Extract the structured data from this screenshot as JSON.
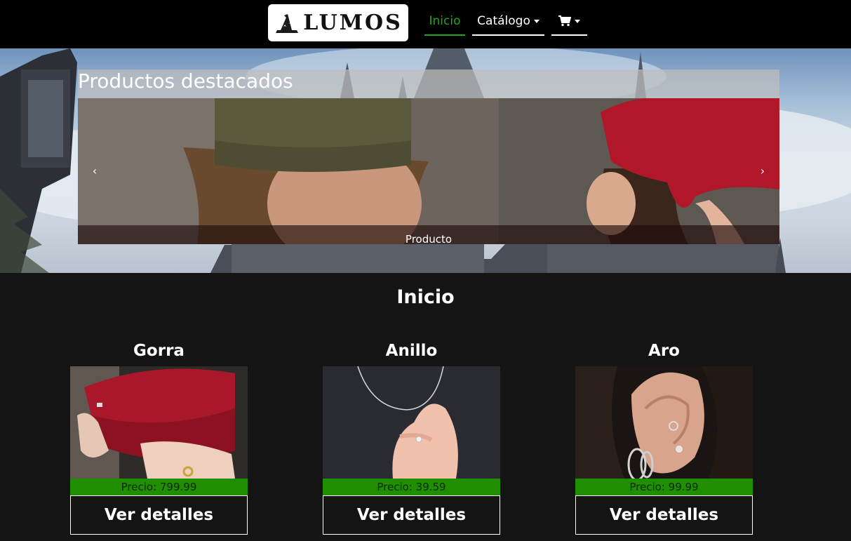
{
  "navbar": {
    "logo_text": "LUMOS",
    "items": [
      {
        "label": "Inicio",
        "active": true
      },
      {
        "label": "Catálogo"
      },
      {
        "icon": "cart-icon"
      }
    ],
    "accent_color": "#1ea51e"
  },
  "hero": {
    "title": "Productos destacados",
    "carousel": {
      "caption": "Producto",
      "prev_icon": "chevron-left-icon",
      "next_icon": "chevron-right-icon"
    }
  },
  "main": {
    "title": "Inicio",
    "products": [
      {
        "name": "Gorra",
        "price_label": "Precio: 799.99",
        "button_label": "Ver detalles"
      },
      {
        "name": "Anillo",
        "price_label": "Precio: 39.59",
        "button_label": "Ver detalles"
      },
      {
        "name": "Aro",
        "price_label": "Precio: 99.99",
        "button_label": "Ver detalles"
      }
    ]
  },
  "colors": {
    "price_bar": "#1f8f00",
    "background": "#141414"
  }
}
